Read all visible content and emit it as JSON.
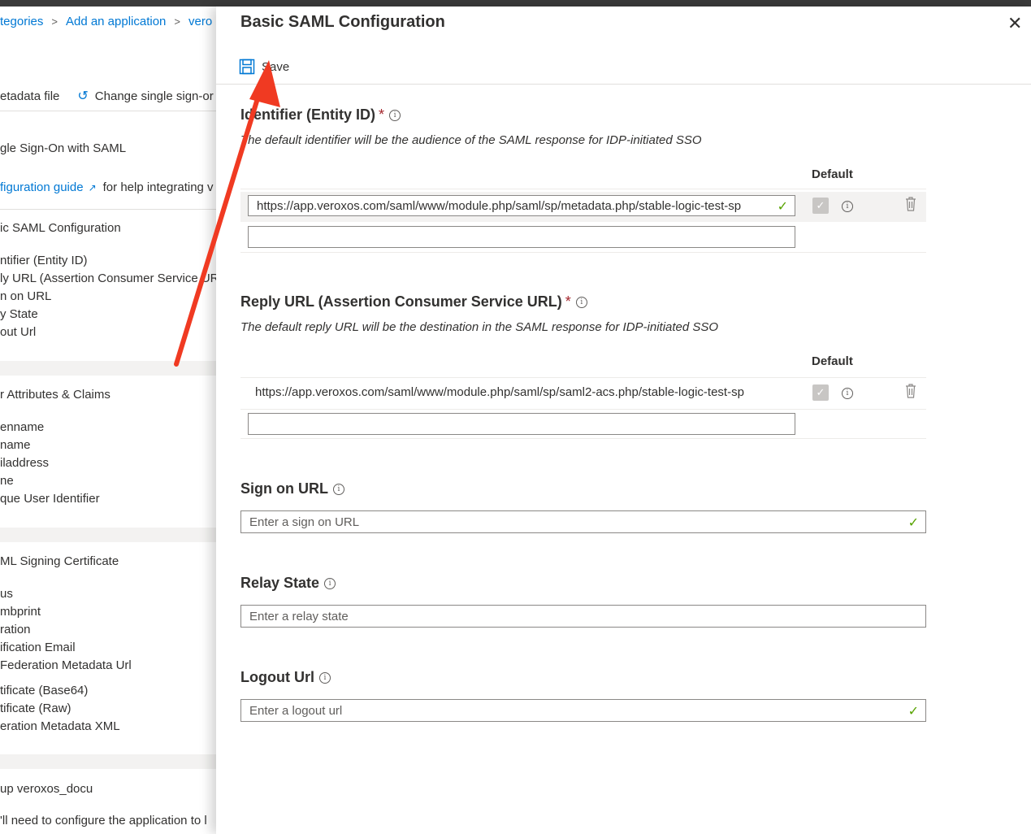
{
  "background_blade": {
    "breadcrumb": [
      "tegories",
      "Add an application",
      "vero"
    ],
    "commands": {
      "metadata": "etadata file",
      "change_sso": "Change single sign-or"
    },
    "heading": "gle Sign-On with SAML",
    "guide": {
      "link": "figuration guide",
      "rest": "for help integrating v"
    },
    "basic_section": {
      "title": "ic SAML Configuration",
      "items": [
        "ntifier (Entity ID)",
        "ly URL (Assertion Consumer Service URL",
        "n on URL",
        "y State",
        "out Url"
      ]
    },
    "claims_section": {
      "title": "r Attributes & Claims",
      "items": [
        "enname",
        "name",
        "iladdress",
        "ne",
        "que User Identifier"
      ]
    },
    "cert_section": {
      "title": "ML Signing Certificate",
      "items": [
        "us",
        "mbprint",
        "ration",
        "ification Email",
        "Federation Metadata Url"
      ],
      "downloads": [
        "tificate (Base64)",
        "tificate (Raw)",
        "eration Metadata XML"
      ]
    },
    "setup_section": {
      "title": "up veroxos_docu",
      "text": "'ll need to configure the application to l"
    }
  },
  "panel": {
    "title": "Basic SAML Configuration",
    "save_label": "Save",
    "identifier": {
      "label": "Identifier (Entity ID)",
      "required": "*",
      "description": "The default identifier will be the audience of the SAML response for IDP-initiated SSO",
      "default_header": "Default",
      "value": "https://app.veroxos.com/saml/www/module.php/saml/sp/metadata.php/stable-logic-test-sp"
    },
    "reply_url": {
      "label": "Reply URL (Assertion Consumer Service URL)",
      "required": "*",
      "description": "The default reply URL will be the destination in the SAML response for IDP-initiated SSO",
      "default_header": "Default",
      "value": "https://app.veroxos.com/saml/www/module.php/saml/sp/saml2-acs.php/stable-logic-test-sp"
    },
    "sign_on": {
      "label": "Sign on URL",
      "placeholder": "Enter a sign on URL"
    },
    "relay_state": {
      "label": "Relay State",
      "placeholder": "Enter a relay state"
    },
    "logout": {
      "label": "Logout Url",
      "placeholder": "Enter a logout url"
    }
  },
  "colors": {
    "accent": "#0078d4",
    "required": "#a4262c",
    "valid_check": "#57a300",
    "annotation_arrow": "#f03a22"
  }
}
